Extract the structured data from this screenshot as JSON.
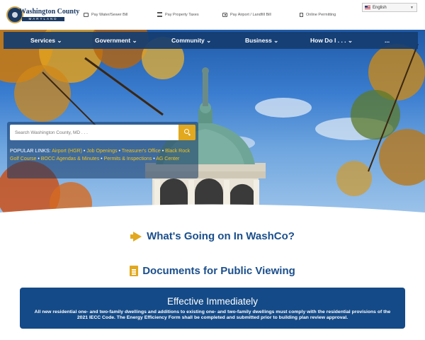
{
  "brand": {
    "name": "Washington County",
    "state": "MARYLAND"
  },
  "quick_links": [
    {
      "label": "Pay Water/Sewer Bill",
      "icon": "bill-icon"
    },
    {
      "label": "Pay Property Taxes",
      "icon": "bank-icon"
    },
    {
      "label": "Pay Airport / Landfill Bill",
      "icon": "ticket-icon"
    },
    {
      "label": "Online Permitting",
      "icon": "document-icon"
    }
  ],
  "language": {
    "selected": "English"
  },
  "nav": [
    "Services",
    "Government",
    "Community",
    "Business",
    "How Do I . . .",
    "..."
  ],
  "search": {
    "placeholder": "Search Washington County, MD . . ."
  },
  "popular_links": {
    "label": "POPULAR LINKS:",
    "links": [
      "Airport (HGR)",
      "Job Openings",
      "Treasurer's Office",
      "Black Rock Golf Course",
      "BOCC Agendas & Minutes",
      "Permits & Inspections",
      "AG Center"
    ]
  },
  "sections": {
    "news_title": "What's Going on In WashCo?",
    "docs_title": "Documents for Public Viewing"
  },
  "notice": {
    "title": "Effective Immediately",
    "body": "All new residential one- and two-family dwellings and additions to existing one- and two-family dwellings must comply with the residential provisions of the 2021 IECC Code. The Energy Efficiency Form shall be completed and submitted prior to building plan review approval."
  },
  "colors": {
    "brand_navy": "#1b4f8c",
    "nav_bg": "#153d70",
    "accent_gold": "#e2a81e",
    "link_gold": "#f2c21b"
  }
}
